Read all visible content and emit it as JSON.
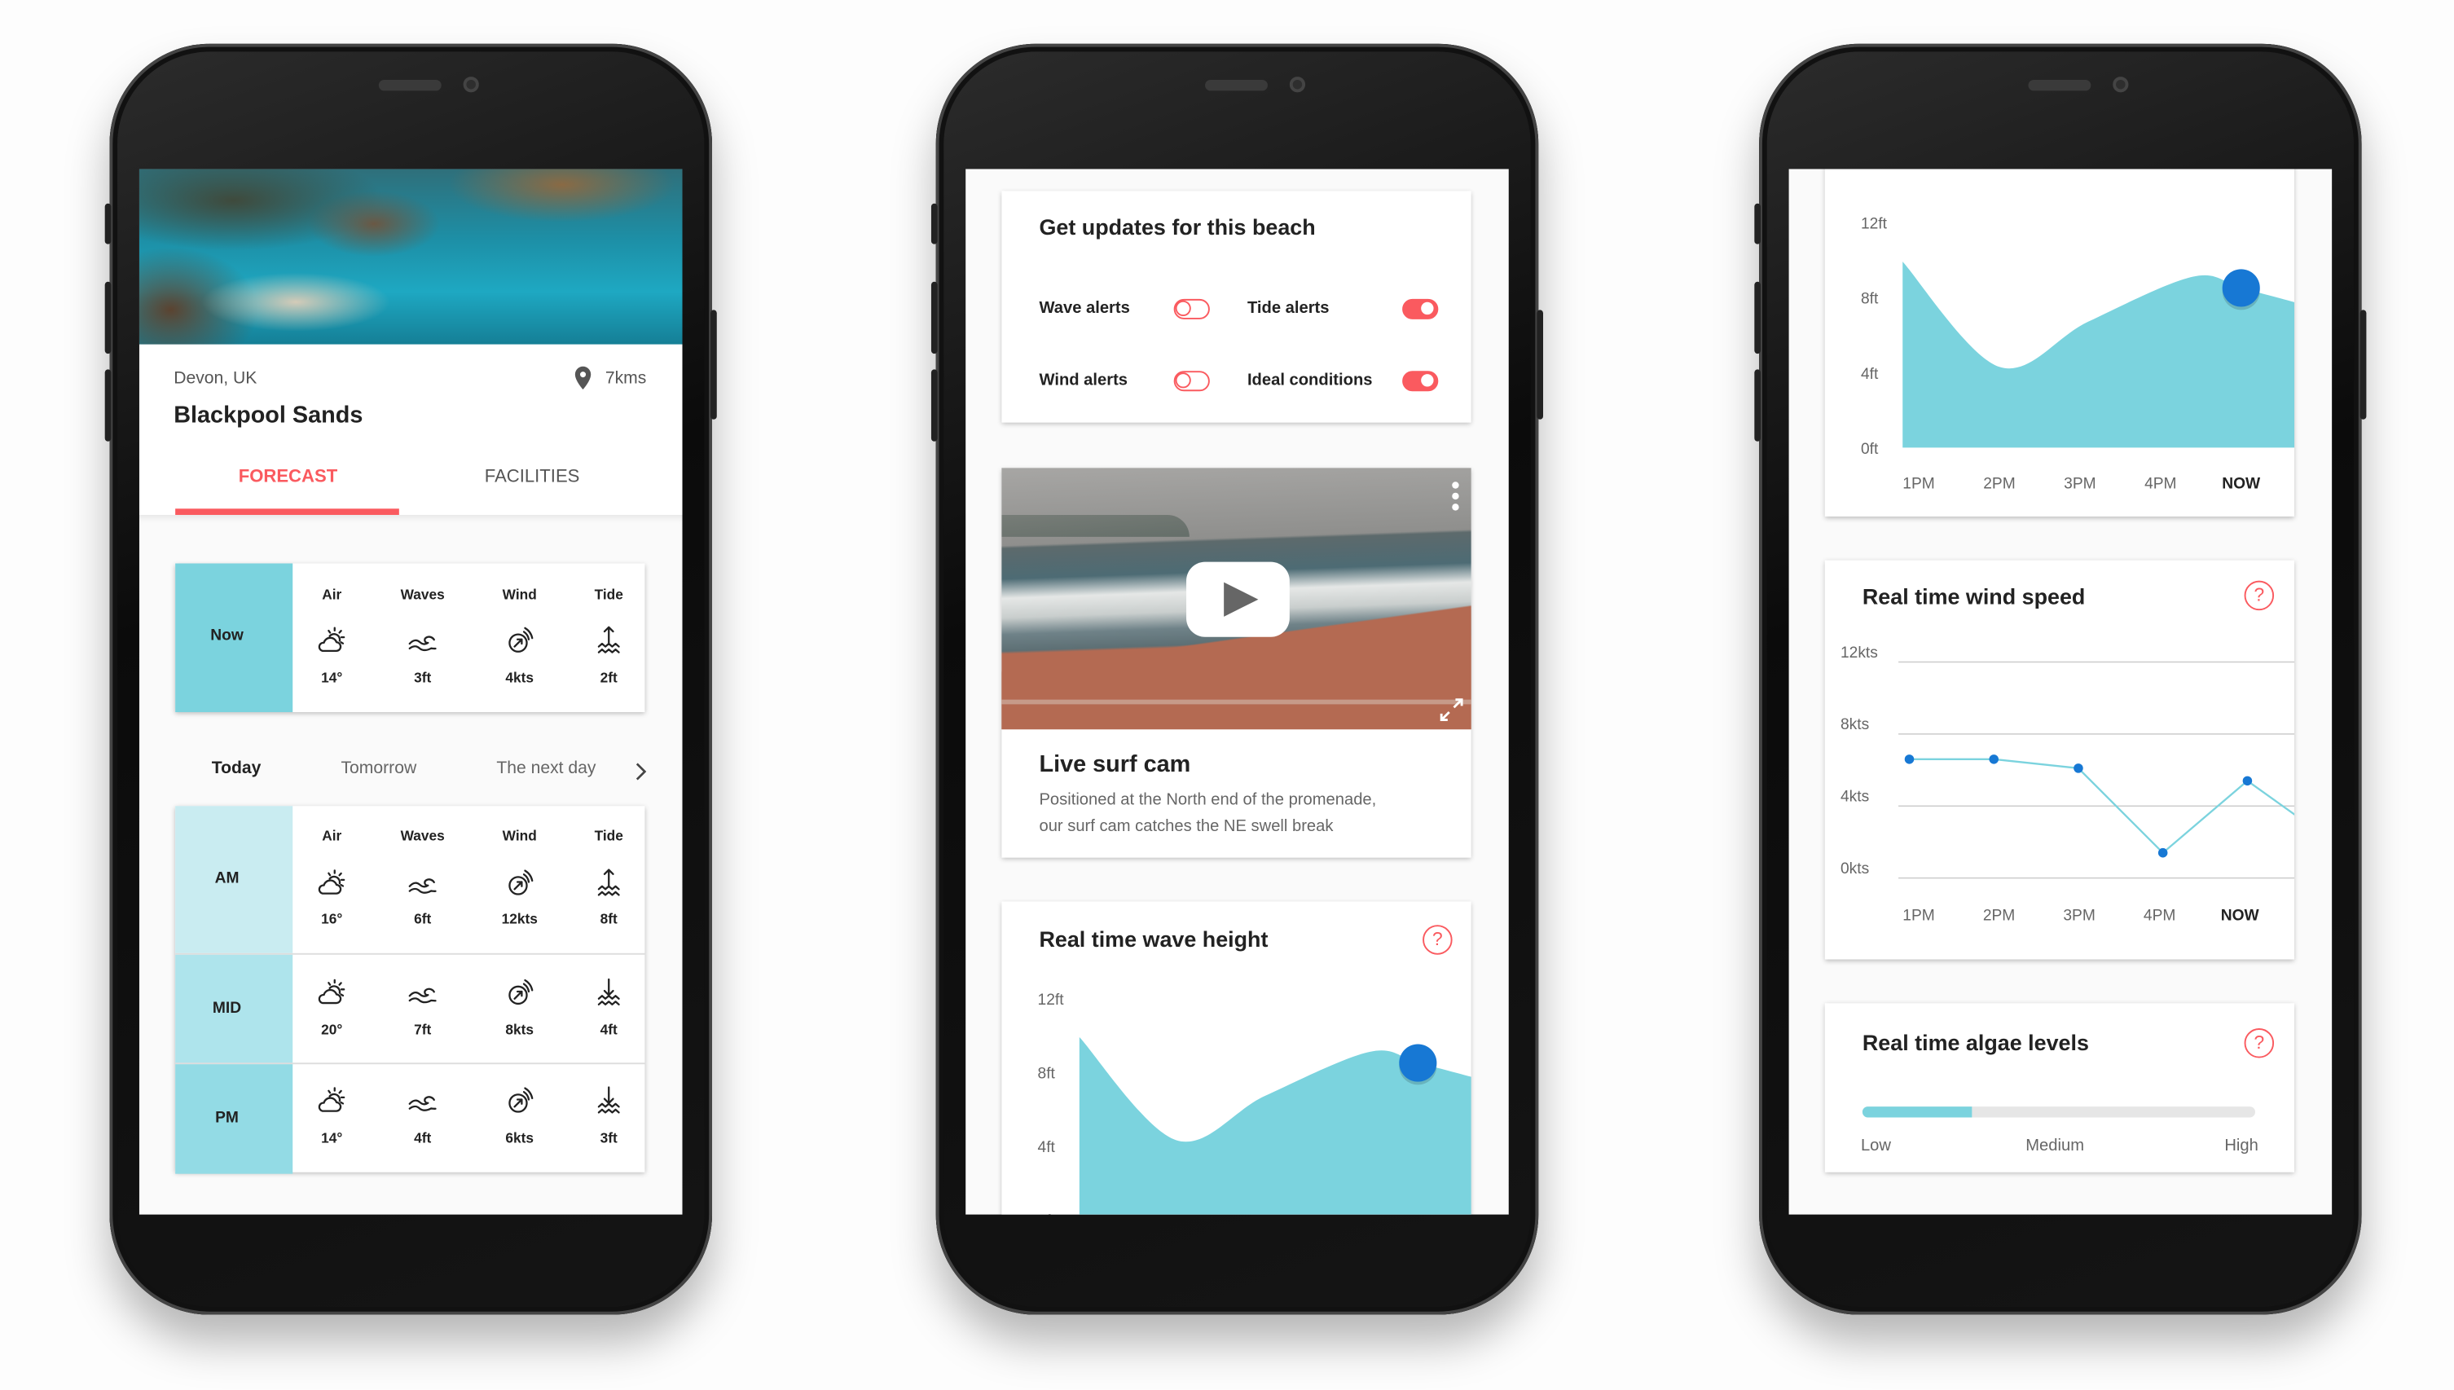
{
  "colors": {
    "accent": "#fa5a5f",
    "teal": "#7bd3de",
    "point": "#1778d4",
    "row_am": "#c9ecf1",
    "row_mid": "#aee4ec",
    "row_pm": "#93dbe5"
  },
  "beach_screen": {
    "location": "Devon, UK",
    "distance": "7kms",
    "name": "Blackpool Sands",
    "tabs": [
      "FORECAST",
      "FACILITIES"
    ],
    "active_tab": "FORECAST",
    "now": {
      "label": "Now",
      "headers": [
        "Air",
        "Waves",
        "Wind",
        "Tide"
      ],
      "cells": [
        {
          "icon": "cloud-sun-icon",
          "value": "14°"
        },
        {
          "icon": "wave-icon",
          "value": "3ft"
        },
        {
          "icon": "wind-icon",
          "value": "4kts"
        },
        {
          "icon": "tide-up-icon",
          "value": "2ft"
        }
      ]
    },
    "day_tabs": [
      "Today",
      "Tomorrow",
      "The next day"
    ],
    "active_day": "Today",
    "forecast": {
      "headers": [
        "Air",
        "Waves",
        "Wind",
        "Tide"
      ],
      "rows": [
        {
          "label": "AM",
          "cells": [
            {
              "icon": "cloud-sun-icon",
              "value": "16°"
            },
            {
              "icon": "wave-icon",
              "value": "6ft"
            },
            {
              "icon": "wind-icon",
              "value": "12kts"
            },
            {
              "icon": "tide-up-icon",
              "value": "8ft"
            }
          ]
        },
        {
          "label": "MID",
          "cells": [
            {
              "icon": "cloud-sun-icon",
              "value": "20°"
            },
            {
              "icon": "wave-icon",
              "value": "7ft"
            },
            {
              "icon": "wind-icon",
              "value": "8kts"
            },
            {
              "icon": "tide-down-icon",
              "value": "4ft"
            }
          ]
        },
        {
          "label": "PM",
          "cells": [
            {
              "icon": "cloud-sun-icon",
              "value": "14°"
            },
            {
              "icon": "wave-icon",
              "value": "4ft"
            },
            {
              "icon": "wind-icon",
              "value": "6kts"
            },
            {
              "icon": "tide-down-icon",
              "value": "3ft"
            }
          ]
        }
      ]
    }
  },
  "updates_screen": {
    "alerts_card": {
      "title": "Get updates for this beach",
      "toggles": [
        {
          "label": "Wave alerts",
          "on": false
        },
        {
          "label": "Tide alerts",
          "on": true
        },
        {
          "label": "Wind alerts",
          "on": false
        },
        {
          "label": "Ideal conditions",
          "on": true
        }
      ]
    },
    "surf_cam": {
      "title": "Live surf cam",
      "description_line1": "Positioned at the North end of the promenade,",
      "description_line2": "our surf cam catches the NE swell break"
    },
    "wave_card": {
      "title": "Real time wave height"
    }
  },
  "charts_screen": {
    "wind_card": {
      "title": "Real time wind speed"
    },
    "algae_card": {
      "title": "Real time algae levels",
      "level": 0.28,
      "labels": [
        "Low",
        "Medium",
        "High"
      ]
    }
  },
  "chart_data": [
    {
      "type": "area",
      "title": "Real time wave height",
      "y_ticks": [
        "12ft",
        "8ft",
        "4ft",
        "0ft"
      ],
      "ylim": [
        0,
        12
      ],
      "x_labels": [],
      "points": [
        {
          "time": "12:48",
          "value": 9.9
        },
        {
          "time": "14:00",
          "value": 4.3
        },
        {
          "time": "15:06",
          "value": 6.7
        },
        {
          "time": "16:24",
          "value": 9.1
        },
        {
          "time": "17:00",
          "value": 8.5
        },
        {
          "time": "17:42",
          "value": 7.7
        }
      ],
      "highlight": {
        "time": "17:00",
        "value": 8.5
      },
      "grid": false
    },
    {
      "type": "area",
      "title": "",
      "y_ticks": [
        "12ft",
        "8ft",
        "4ft",
        "0ft"
      ],
      "ylim": [
        0,
        12
      ],
      "x_labels": [
        "1PM",
        "2PM",
        "3PM",
        "4PM",
        "NOW"
      ],
      "points": [
        {
          "time": "12:48",
          "value": 9.9
        },
        {
          "time": "14:00",
          "value": 4.3
        },
        {
          "time": "15:06",
          "value": 6.7
        },
        {
          "time": "16:24",
          "value": 9.1
        },
        {
          "time": "17:00",
          "value": 8.5
        },
        {
          "time": "17:42",
          "value": 7.7
        }
      ],
      "highlight": {
        "time": "17:00",
        "value": 8.5
      },
      "grid": false
    },
    {
      "type": "line",
      "title": "Real time wind speed",
      "y_ticks": [
        "12kts",
        "8kts",
        "4kts",
        "0kts"
      ],
      "ylim": [
        0,
        12
      ],
      "x_labels": [
        "1PM",
        "2PM",
        "3PM",
        "4PM",
        "NOW"
      ],
      "points": [
        {
          "time": "13:00",
          "value": 6.6
        },
        {
          "time": "14:00",
          "value": 6.6
        },
        {
          "time": "15:00",
          "value": 6.1
        },
        {
          "time": "16:00",
          "value": 1.4
        },
        {
          "time": "17:00",
          "value": 5.4
        }
      ],
      "trailing": {
        "time": "17:34",
        "value": 3.5
      },
      "grid": true
    }
  ]
}
